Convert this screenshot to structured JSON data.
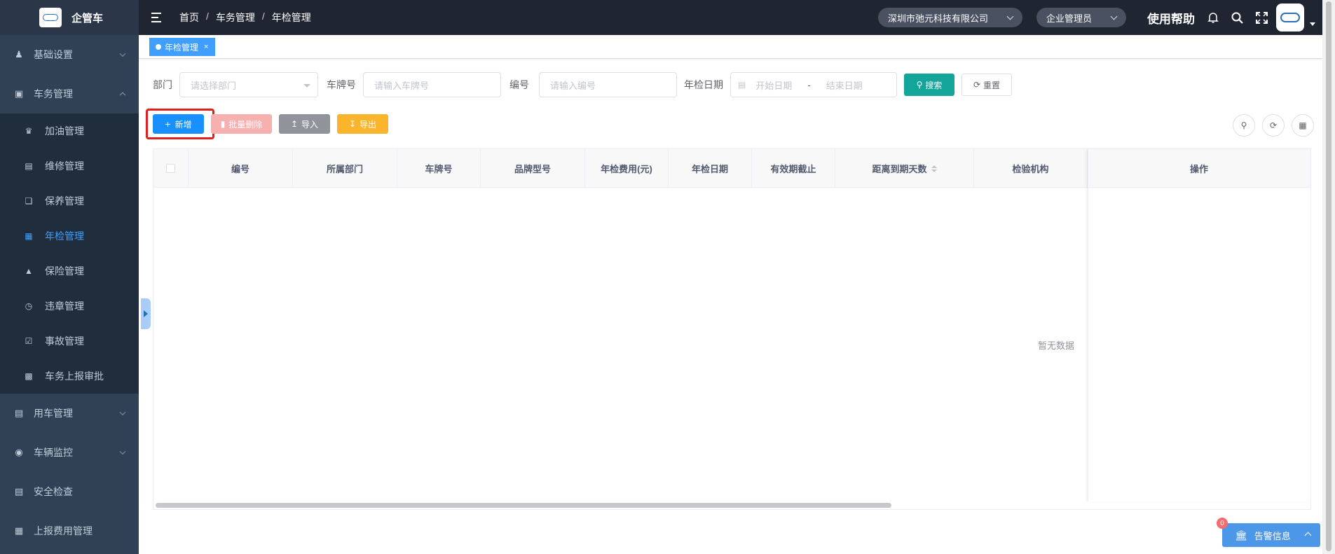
{
  "brand": {
    "name": "企管车"
  },
  "sidebar": {
    "items": [
      {
        "label": "基础设置",
        "icon": "user-group-icon",
        "expanded": false
      },
      {
        "label": "车务管理",
        "icon": "monitor-icon",
        "expanded": true,
        "children": [
          {
            "label": "加油管理",
            "icon": "fuel-icon",
            "active": false
          },
          {
            "label": "维修管理",
            "icon": "toolbox-icon",
            "active": false
          },
          {
            "label": "保养管理",
            "icon": "copy-icon",
            "active": false
          },
          {
            "label": "年检管理",
            "icon": "chart-icon",
            "active": true
          },
          {
            "label": "保险管理",
            "icon": "lock-icon",
            "active": false
          },
          {
            "label": "违章管理",
            "icon": "clock-icon",
            "active": false
          },
          {
            "label": "事故管理",
            "icon": "checkbox-icon",
            "active": false
          },
          {
            "label": "车务上报审批",
            "icon": "document-icon",
            "active": false
          }
        ]
      },
      {
        "label": "用车管理",
        "icon": "car-doc-icon",
        "expanded": false
      },
      {
        "label": "车辆监控",
        "icon": "globe-icon",
        "expanded": false
      },
      {
        "label": "安全检查",
        "icon": "calendar-icon",
        "expanded": false
      },
      {
        "label": "上报费用管理",
        "icon": "grid-icon",
        "expanded": false
      }
    ],
    "active_color": "#409eff"
  },
  "header": {
    "breadcrumb": [
      "首页",
      "车务管理",
      "年检管理"
    ],
    "company": "深圳市弛元科技有限公司",
    "role": "企业管理员",
    "help": "使用帮助"
  },
  "tags": [
    {
      "label": "年检管理",
      "active": true
    }
  ],
  "search": {
    "dept_label": "部门",
    "dept_placeholder": "请选择部门",
    "plate_label": "车牌号",
    "plate_placeholder": "请输入车牌号",
    "code_label": "编号",
    "code_placeholder": "请输入编号",
    "date_label": "年检日期",
    "date_start": "开始日期",
    "date_sep": "-",
    "date_end": "结束日期",
    "search_btn": "搜索",
    "reset_btn": "重置"
  },
  "toolbar": {
    "add": "新增",
    "batch_delete": "批量删除",
    "import": "导入",
    "export": "导出"
  },
  "table": {
    "columns": [
      "编号",
      "所属部门",
      "车牌号",
      "品牌型号",
      "年检费用(元)",
      "年检日期",
      "有效期截止",
      "距离到期天数",
      "检验机构",
      "操作"
    ],
    "empty_text": "暂无数据"
  },
  "alert": {
    "label": "告警信息",
    "count": "0"
  },
  "colors": {
    "primary": "#1890ff",
    "search": "#13a59a",
    "danger_light": "#f7b0b0",
    "warning": "#fbb52c",
    "sidebar": "#304156",
    "header": "#202532"
  }
}
